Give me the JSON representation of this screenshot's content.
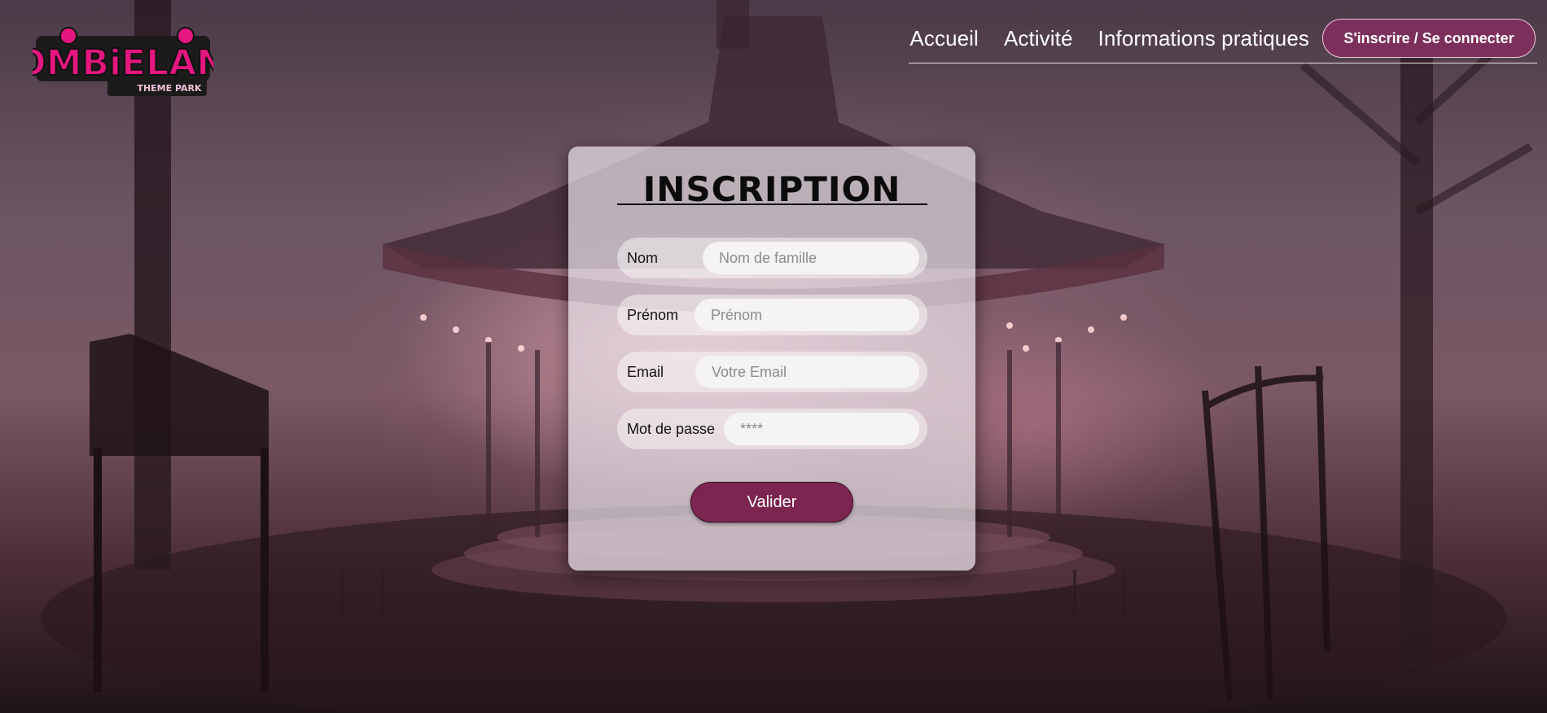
{
  "brand": {
    "logo_text": "ZOMBiELAND",
    "logo_subtext": "THEME PARK",
    "accent_color": "#e5177f",
    "button_color": "#7b2550"
  },
  "nav": {
    "links": [
      "Accueil",
      "Activité",
      "Informations pratiques"
    ],
    "login_button": "S'inscrire / Se connecter"
  },
  "form": {
    "title": "INSCRIPTION",
    "fields": [
      {
        "label": "Nom",
        "placeholder": "Nom de famille"
      },
      {
        "label": "Prénom",
        "placeholder": "Prénom"
      },
      {
        "label": "Email",
        "placeholder": "Votre Email"
      },
      {
        "label": "Mot de passe",
        "placeholder": "****"
      }
    ],
    "submit_label": "Valider"
  }
}
